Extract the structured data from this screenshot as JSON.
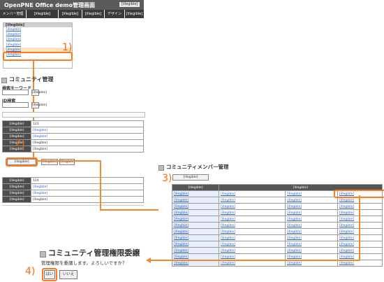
{
  "header": {
    "title": "OpenPNE Office demo管理画面",
    "badge": "[illegible]"
  },
  "nav": [
    {
      "label": "メンバー管理"
    },
    {
      "label": "[illegible]"
    },
    {
      "label": "[illegible]"
    },
    {
      "label": "[illegible]"
    },
    {
      "label": "デザイン"
    },
    {
      "label": "[illegible]"
    }
  ],
  "side_menu": {
    "heading": "[illegible]",
    "items": [
      {
        "label": "[illegible]"
      },
      {
        "label": "[illegible]"
      },
      {
        "label": "[illegible]"
      },
      {
        "label": "[illegible]"
      },
      {
        "label": "[illegible]"
      },
      {
        "label": "[illegible]"
      }
    ]
  },
  "steps": {
    "s1": "1)",
    "s2": "2)",
    "s3": "3)",
    "s4": "4)"
  },
  "community": {
    "title": "コミュニティ管理",
    "search_label": "検索キーワード",
    "id_label": "ID検索",
    "search_button": "[illegible]",
    "id_button": "[illegible]"
  },
  "record1": {
    "rows": [
      {
        "label": "[illegible]",
        "value": "123"
      },
      {
        "label": "[illegible]",
        "value": "[illegible]"
      },
      {
        "label": "[illegible]",
        "value": "[illegible]"
      },
      {
        "label": "[illegible]",
        "value": "[illegible]"
      },
      {
        "label": "[illegible]",
        "value": "[illegible]"
      }
    ],
    "member_button": "[illegible]",
    "btn2": "[illegible]",
    "btn3": "[illegible]"
  },
  "record2": {
    "rows": [
      {
        "label": "[illegible]",
        "value": "124"
      },
      {
        "label": "[illegible]",
        "value": "[illegible]"
      },
      {
        "label": "[illegible]",
        "value": "[illegible]"
      },
      {
        "label": "[illegible]",
        "value": "[illegible]"
      }
    ]
  },
  "member_panel": {
    "title": "コミュニティメンバー管理",
    "back_button": "[illegible]",
    "col_name": "[illegible]",
    "col_ops": "[illegible]",
    "members": [
      {
        "name": "[illegible]",
        "op1": "[illegible]",
        "op2": "[illegible]",
        "op3": "[illegible]"
      },
      {
        "name": "[illegible]",
        "op1": "[illegible]",
        "op2": "[illegible]",
        "op3": "[illegible]"
      },
      {
        "name": "[illegible]",
        "op1": "[illegible]",
        "op2": "[illegible]",
        "op3": "[illegible]"
      },
      {
        "name": "[illegible]",
        "op1": "[illegible]",
        "op2": "[illegible]",
        "op3": "[illegible]"
      },
      {
        "name": "[illegible]",
        "op1": "[illegible]",
        "op2": "[illegible]",
        "op3": "[illegible]"
      },
      {
        "name": "[illegible]",
        "op1": "[illegible]",
        "op2": "[illegible]",
        "op3": "[illegible]"
      },
      {
        "name": "[illegible]",
        "op1": "[illegible]",
        "op2": "[illegible]",
        "op3": "[illegible]"
      },
      {
        "name": "[illegible]",
        "op1": "[illegible]",
        "op2": "[illegible]",
        "op3": "[illegible]"
      },
      {
        "name": "[illegible]",
        "op1": "[illegible]",
        "op2": "[illegible]",
        "op3": "[illegible]"
      },
      {
        "name": "[illegible]",
        "op1": "[illegible]",
        "op2": "[illegible]",
        "op3": "[illegible]"
      },
      {
        "name": "[illegible]",
        "op1": "[illegible]",
        "op2": "[illegible]",
        "op3": "[illegible]"
      },
      {
        "name": "[illegible]",
        "op1": "[illegible]",
        "op2": "[illegible]",
        "op3": "[illegible]"
      }
    ]
  },
  "confirm": {
    "title": "コミュニティ管理権限委譲",
    "message": "管理権限を委譲します。よろしいですか？",
    "yes_button": "はい",
    "cancel_button": "いいえ"
  },
  "colors": {
    "accent": "#f08a2a",
    "nav_bg": "#3a3a3a",
    "link": "#2a63c9"
  }
}
